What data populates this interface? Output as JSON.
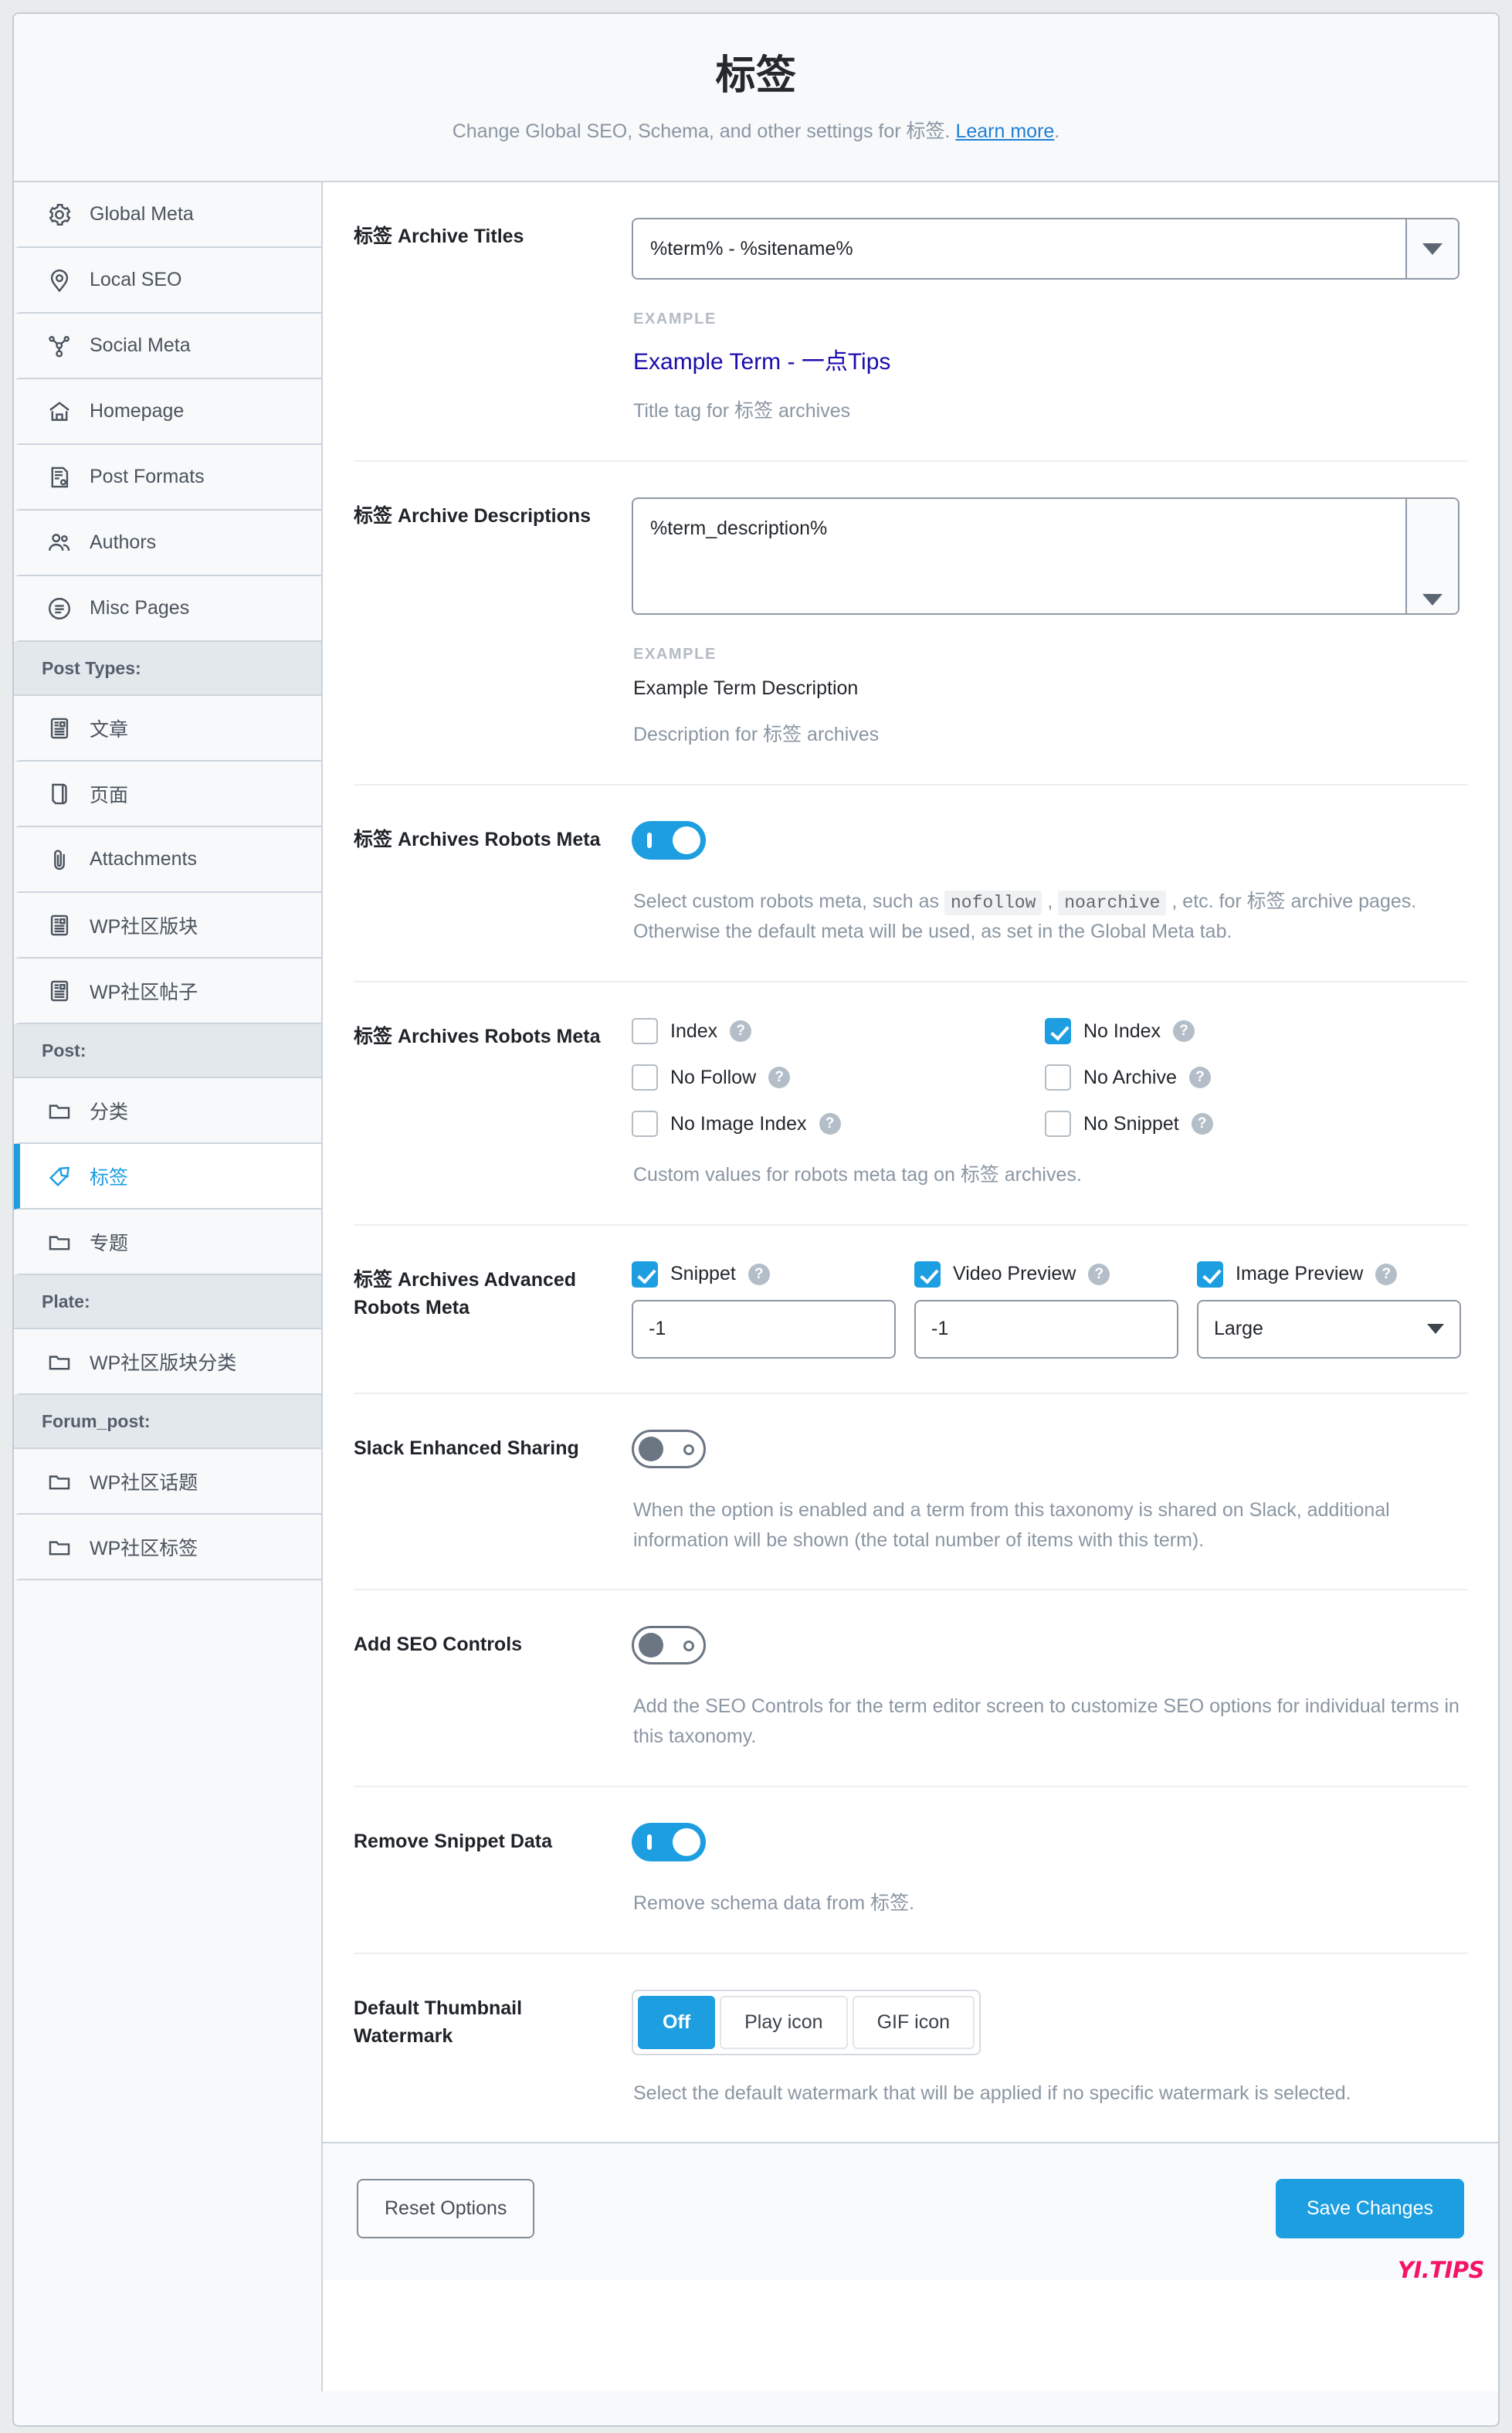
{
  "header": {
    "title": "标签",
    "subtitle_before": "Change Global SEO, Schema, and other settings for 标签. ",
    "learn_more": "Learn more",
    "subtitle_after": "."
  },
  "sidebar": {
    "items": [
      {
        "type": "item",
        "label": "Global Meta",
        "icon": "gear-icon",
        "active": false
      },
      {
        "type": "item",
        "label": "Local SEO",
        "icon": "map-pin-icon",
        "active": false
      },
      {
        "type": "item",
        "label": "Social Meta",
        "icon": "share-nodes-icon",
        "active": false
      },
      {
        "type": "item",
        "label": "Homepage",
        "icon": "home-icon",
        "active": false
      },
      {
        "type": "item",
        "label": "Post Formats",
        "icon": "certificate-document-icon",
        "active": false
      },
      {
        "type": "item",
        "label": "Authors",
        "icon": "users-icon",
        "active": false
      },
      {
        "type": "item",
        "label": "Misc Pages",
        "icon": "list-circle-icon",
        "active": false
      },
      {
        "type": "group",
        "label": "Post Types:"
      },
      {
        "type": "item",
        "label": "文章",
        "icon": "article-icon",
        "active": false
      },
      {
        "type": "item",
        "label": "页面",
        "icon": "page-icon",
        "active": false
      },
      {
        "type": "item",
        "label": "Attachments",
        "icon": "paperclip-icon",
        "active": false
      },
      {
        "type": "item",
        "label": "WP社区版块",
        "icon": "article-icon",
        "active": false
      },
      {
        "type": "item",
        "label": "WP社区帖子",
        "icon": "article-icon",
        "active": false
      },
      {
        "type": "group",
        "label": "Post:"
      },
      {
        "type": "item",
        "label": "分类",
        "icon": "folder-icon",
        "active": false
      },
      {
        "type": "item",
        "label": "标签",
        "icon": "tag-icon",
        "active": true
      },
      {
        "type": "item",
        "label": "专题",
        "icon": "folder-icon",
        "active": false
      },
      {
        "type": "group",
        "label": "Plate:"
      },
      {
        "type": "item",
        "label": "WP社区版块分类",
        "icon": "folder-icon",
        "active": false
      },
      {
        "type": "group",
        "label": "Forum_post:"
      },
      {
        "type": "item",
        "label": "WP社区话题",
        "icon": "folder-icon",
        "active": false
      },
      {
        "type": "item",
        "label": "WP社区标签",
        "icon": "folder-icon",
        "active": false
      }
    ]
  },
  "settings": {
    "archive_titles": {
      "label": "标签 Archive Titles",
      "value": "%term% - %sitename%",
      "example_label": "EXAMPLE",
      "example_value": "Example Term - 一点Tips",
      "help": "Title tag for 标签 archives"
    },
    "archive_descriptions": {
      "label": "标签 Archive Descriptions",
      "value": "%term_description%",
      "example_label": "EXAMPLE",
      "example_value": "Example Term Description",
      "help": "Description for 标签 archives"
    },
    "robots_meta_toggle": {
      "label": "标签 Archives Robots Meta",
      "state": "on",
      "help_part1": "Select custom robots meta, such as ",
      "code1": "nofollow",
      "help_sep": " , ",
      "code2": "noarchive",
      "help_part2": " , etc. for 标签 archive pages. Otherwise the default meta will be used, as set in the Global Meta tab."
    },
    "robots_meta_checks": {
      "label": "标签 Archives Robots Meta",
      "options": [
        {
          "label": "Index",
          "checked": false
        },
        {
          "label": "No Index",
          "checked": true
        },
        {
          "label": "No Follow",
          "checked": false
        },
        {
          "label": "No Archive",
          "checked": false
        },
        {
          "label": "No Image Index",
          "checked": false
        },
        {
          "label": "No Snippet",
          "checked": false
        }
      ],
      "help": "Custom values for robots meta tag on 标签 archives."
    },
    "advanced_robots": {
      "label": "标签 Archives Advanced Robots Meta",
      "columns": [
        {
          "check_label": "Snippet",
          "checked": true,
          "value": "-1",
          "is_select": false
        },
        {
          "check_label": "Video Preview",
          "checked": true,
          "value": "-1",
          "is_select": false
        },
        {
          "check_label": "Image Preview",
          "checked": true,
          "value": "Large",
          "is_select": true
        }
      ]
    },
    "slack_sharing": {
      "label": "Slack Enhanced Sharing",
      "state": "off",
      "help": "When the option is enabled and a term from this taxonomy is shared on Slack, additional information will be shown (the total number of items with this term)."
    },
    "seo_controls": {
      "label": "Add SEO Controls",
      "state": "off",
      "help": "Add the SEO Controls for the term editor screen to customize SEO options for individual terms in this taxonomy."
    },
    "remove_snippet": {
      "label": "Remove Snippet Data",
      "state": "on",
      "help": "Remove schema data from 标签."
    },
    "watermark": {
      "label": "Default Thumbnail Watermark",
      "options": [
        "Off",
        "Play icon",
        "GIF icon"
      ],
      "selected": "Off",
      "help": "Select the default watermark that will be applied if no specific watermark is selected."
    }
  },
  "footer": {
    "reset_label": "Reset Options",
    "save_label": "Save Changes",
    "watermark_text": "YI.TIPS"
  },
  "colors": {
    "accent": "#1c9ee0",
    "link": "#1f7fd4",
    "example_link": "#1a0dab",
    "watermark": "#f51364"
  }
}
